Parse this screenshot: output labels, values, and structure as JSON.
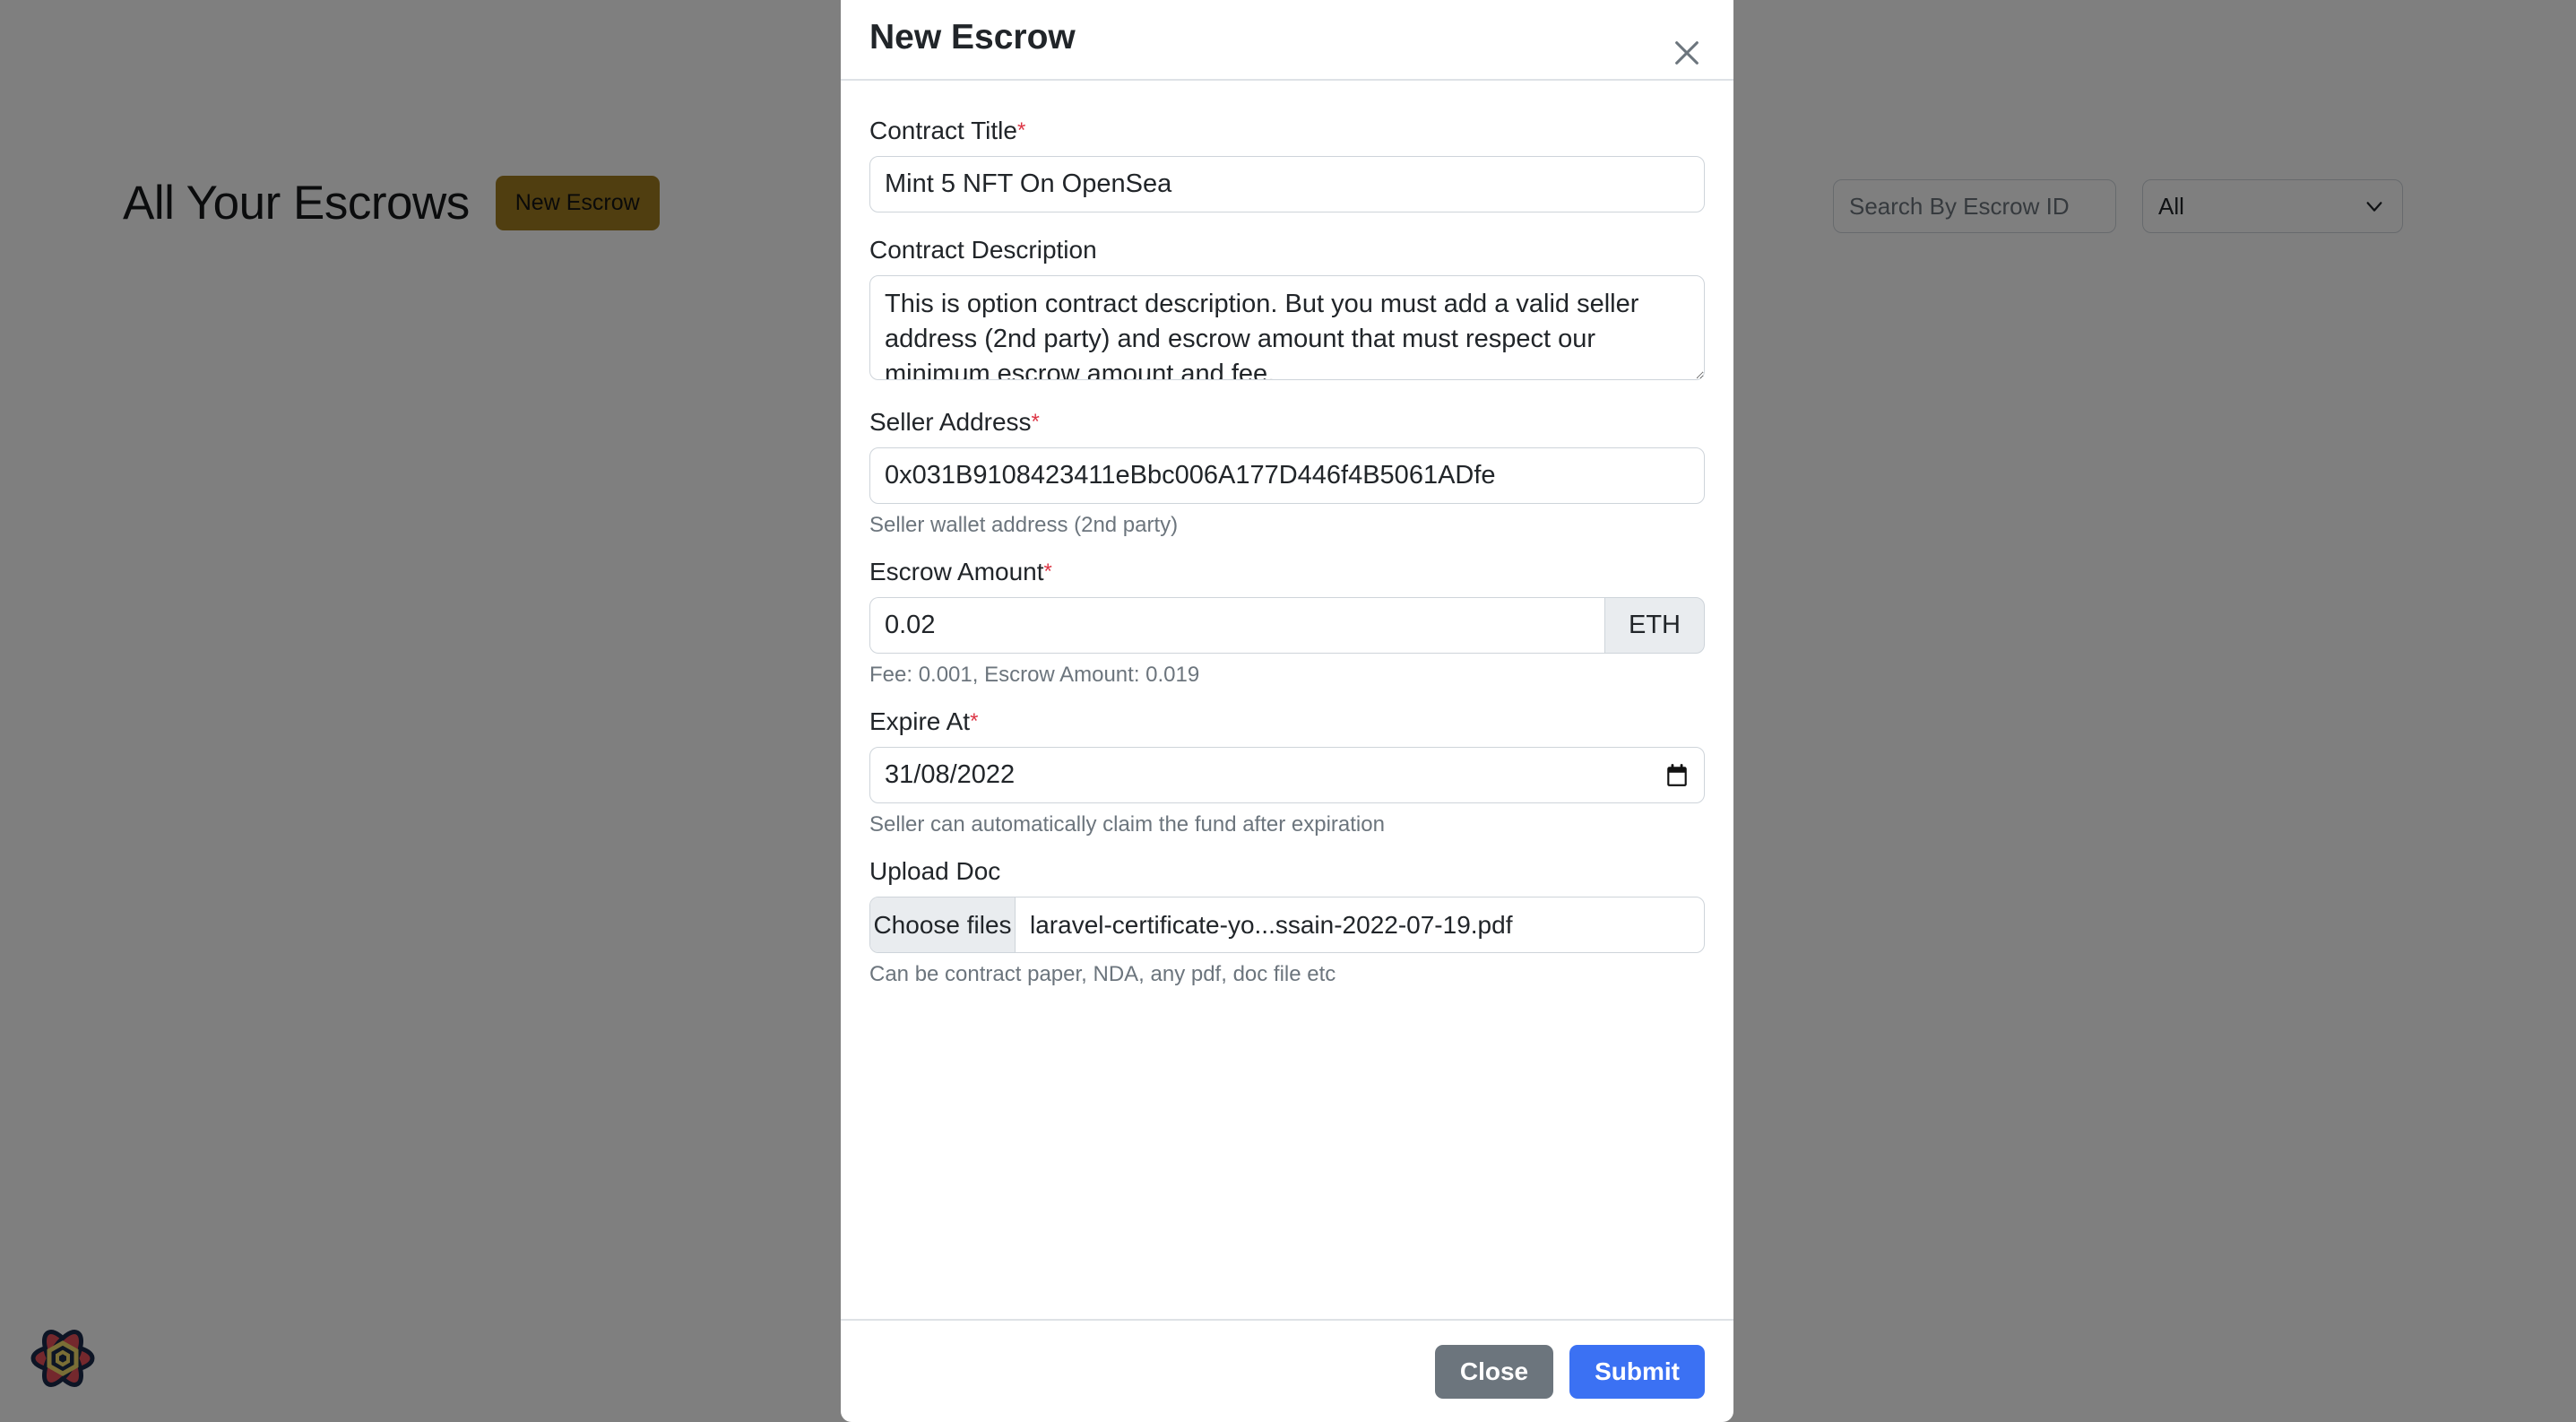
{
  "background": {
    "page_title": "All Your Escrows",
    "new_escrow_button": "New Escrow",
    "search_placeholder": "Search By Escrow ID",
    "search_value": "",
    "filter_selected": "All",
    "logo_name": "flower-atom-logo"
  },
  "modal": {
    "title": "New Escrow",
    "close_icon": "close-icon",
    "fields": {
      "contract_title": {
        "label": "Contract Title",
        "required_marker": "*",
        "value": "Mint 5 NFT On OpenSea"
      },
      "contract_description": {
        "label": "Contract Description",
        "value": "This is option contract description. But you must add a valid seller address (2nd party) and escrow amount that must respect our minimum escrow amount and fee."
      },
      "seller_address": {
        "label": "Seller Address",
        "required_marker": "*",
        "value": "0x031B9108423411eBbc006A177D446f4B5061ADfe",
        "help": "Seller wallet address (2nd party)"
      },
      "escrow_amount": {
        "label": "Escrow Amount",
        "required_marker": "*",
        "value": "0.02",
        "unit": "ETH",
        "help": "Fee: 0.001, Escrow Amount: 0.019"
      },
      "expire_at": {
        "label": "Expire At",
        "required_marker": "*",
        "value": "31/08/2022",
        "help": "Seller can automatically claim the fund after expiration",
        "icon": "calendar-icon"
      },
      "upload_doc": {
        "label": "Upload Doc",
        "button_label": "Choose files",
        "file_name": "laravel-certificate-yo...ssain-2022-07-19.pdf",
        "help": "Can be contract paper, NDA, any pdf, doc file etc"
      }
    },
    "footer": {
      "close_label": "Close",
      "submit_label": "Submit"
    }
  },
  "colors": {
    "submit_blue": "#3b71f3",
    "close_gray": "#6c757d",
    "new_escrow_gold": "#a07d20",
    "required_red": "#dc3545",
    "overlay": "rgba(0,0,0,0.5)"
  }
}
